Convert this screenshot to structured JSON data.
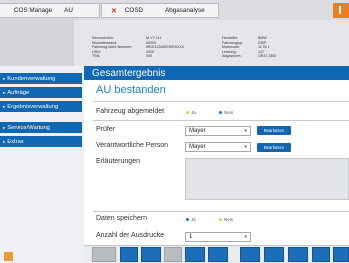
{
  "topbar": {
    "tab1_label": "COS Manage",
    "tab1_sub": "AU",
    "tab2_close": "✕",
    "tab2_label": "COSD",
    "tab2_sub": "Abgasanalyse"
  },
  "info": {
    "col1": [
      "Kennzeichen:",
      "Kilometerstand:",
      "Fahrzeug-Ident-Nummer:",
      "HSN:",
      "TSN:"
    ],
    "col2": [
      "M-YY 111",
      "50000",
      "WDD1234567890XXXX",
      "0000",
      "000"
    ],
    "col3": [
      "Hersteller:",
      "Fahrzeugtyp:",
      "Motorcode:",
      "Leistung:",
      "Abgasnorm:"
    ],
    "col4": [
      "BMW",
      "230P",
      "11 00 1",
      "147",
      "OR47-OBD"
    ]
  },
  "sidebar": {
    "items": [
      {
        "label": "Kundenverwaltung"
      },
      {
        "label": "Aufträge"
      },
      {
        "label": "Ergebnisverwaltung"
      },
      {
        "label": "Service/Wartung"
      },
      {
        "label": "Extras"
      }
    ]
  },
  "main": {
    "header": "Gesamtergebnis",
    "status": "AU bestanden",
    "fahrzeug_label": "Fahrzeug abgemeldet",
    "ja": "Ja",
    "nein": "Nein",
    "pruefer_label": "Prüfer",
    "pruefer_value": "Mayer",
    "verantwortlich_label": "Verantwortliche Person",
    "verantwortlich_value": "Mayer",
    "bearbeiten": "Bearbeiten",
    "erlaeuterungen_label": "Erläuterungen",
    "erlaeuterungen_value": "",
    "daten_label": "Daten speichern",
    "ausdrucke_label": "Anzahl der Ausdrucke",
    "ausdrucke_value": "1"
  },
  "colors": {
    "accent_blue": "#0f68b4",
    "status_text": "#1c7fd0",
    "alert_orange": "#ee7d1a"
  },
  "icons": [
    "close-icon",
    "dropdown-arrow-icon",
    "arrow-right-icon",
    "warning-icon",
    "next-icon"
  ]
}
